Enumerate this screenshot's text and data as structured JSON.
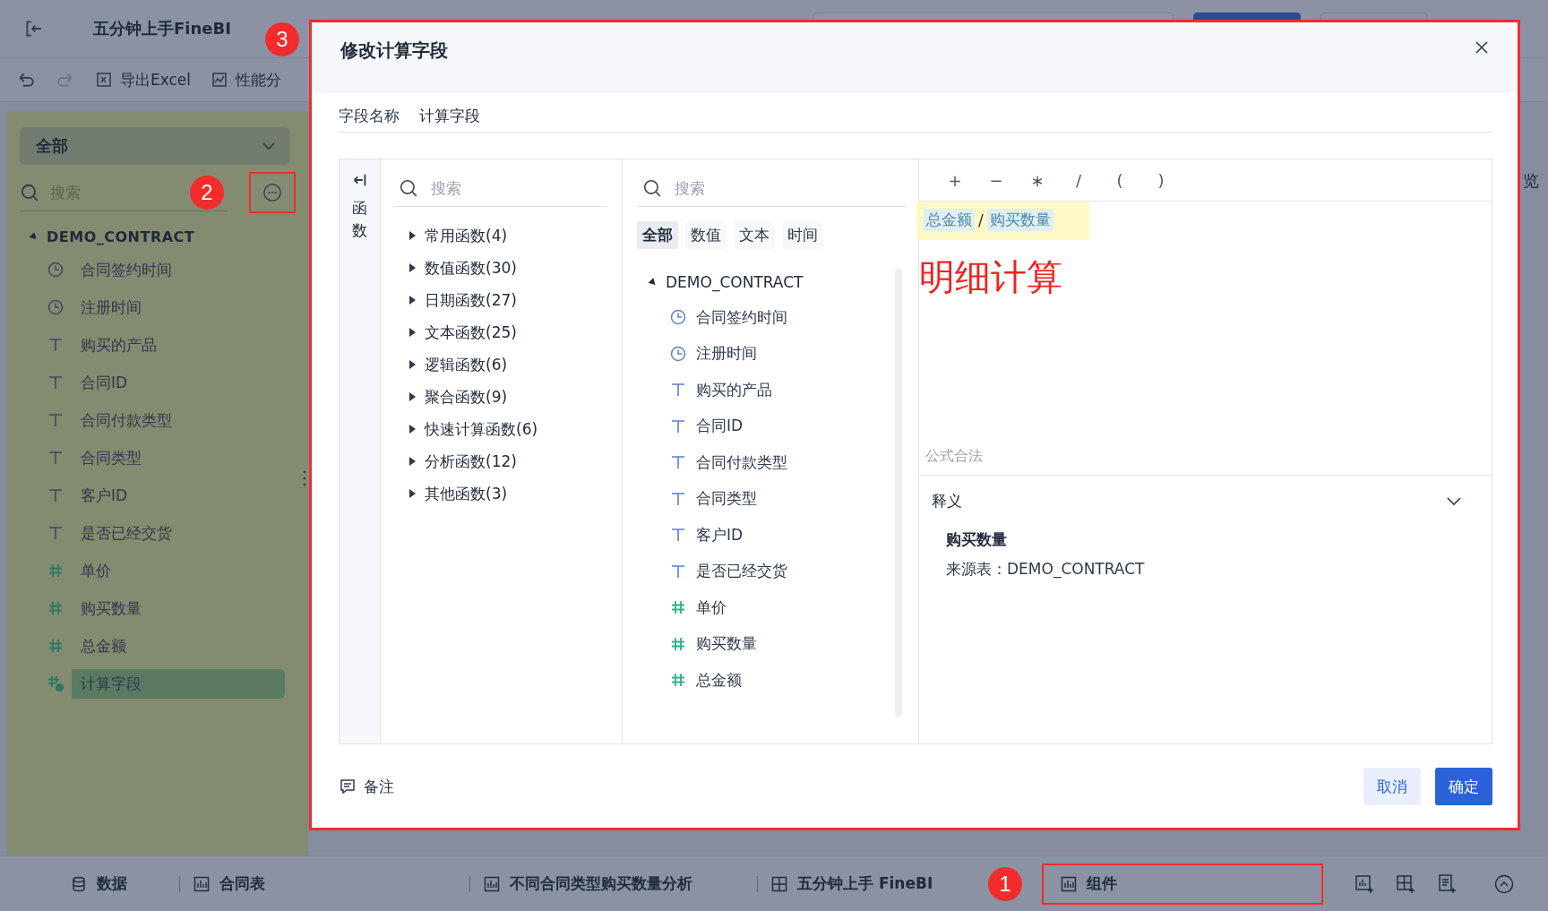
{
  "app": {
    "title": "五分钟上手FineBI"
  },
  "toolbar": [
    {
      "kind": "undo"
    },
    {
      "kind": "redo"
    },
    {
      "kind": "export",
      "label": "导出Excel"
    },
    {
      "kind": "performance",
      "label": "性能分"
    }
  ],
  "right_panel": {
    "label": "览"
  },
  "left_panel": {
    "dropdown": "全部",
    "search": {
      "placeholder": "搜索"
    },
    "more_button": {
      "highlighted": true,
      "callout": "2"
    },
    "tree": {
      "label": "DEMO_CONTRACT",
      "expanded": true,
      "children": [
        {
          "label": "合同签约时间",
          "kind": "time",
          "selected": false
        },
        {
          "label": "注册时间",
          "kind": "time",
          "selected": false
        },
        {
          "label": "购买的产品",
          "kind": "text",
          "selected": false
        },
        {
          "label": "合同ID",
          "kind": "text",
          "selected": false
        },
        {
          "label": "合同付款类型",
          "kind": "text",
          "selected": false
        },
        {
          "label": "合同类型",
          "kind": "text",
          "selected": false
        },
        {
          "label": "客户ID",
          "kind": "text",
          "selected": false
        },
        {
          "label": "是否已经交货",
          "kind": "text",
          "selected": false
        },
        {
          "label": "单价",
          "kind": "number",
          "selected": false
        },
        {
          "label": "购买数量",
          "kind": "number",
          "selected": false
        },
        {
          "label": "总金额",
          "kind": "number",
          "selected": false
        },
        {
          "label": "计算字段",
          "kind": "calc",
          "selected": true
        }
      ]
    }
  },
  "dialog": {
    "title": "修改计算字段",
    "callout": "3",
    "highlighted": true,
    "field_name": {
      "label": "字段名称",
      "value": "计算字段"
    },
    "side_tab": {
      "label": "函数"
    },
    "functions": {
      "search": {
        "placeholder": "搜索"
      },
      "groups": [
        {
          "label": "常用函数(4)",
          "expanded": false
        },
        {
          "label": "数值函数(30)",
          "expanded": false
        },
        {
          "label": "日期函数(27)",
          "expanded": false
        },
        {
          "label": "文本函数(25)",
          "expanded": false
        },
        {
          "label": "逻辑函数(6)",
          "expanded": false
        },
        {
          "label": "聚合函数(9)",
          "expanded": false
        },
        {
          "label": "快速计算函数(6)",
          "expanded": false
        },
        {
          "label": "分析函数(12)",
          "expanded": false
        },
        {
          "label": "其他函数(3)",
          "expanded": false
        }
      ]
    },
    "fields": {
      "search": {
        "placeholder": "搜索"
      },
      "filters": [
        {
          "label": "全部",
          "selected": true
        },
        {
          "label": "数值",
          "selected": false
        },
        {
          "label": "文本",
          "selected": false
        },
        {
          "label": "时间",
          "selected": false
        }
      ],
      "tree": {
        "label": "DEMO_CONTRACT",
        "expanded": true,
        "children": [
          {
            "label": "合同签约时间",
            "kind": "time"
          },
          {
            "label": "注册时间",
            "kind": "time"
          },
          {
            "label": "购买的产品",
            "kind": "text"
          },
          {
            "label": "合同ID",
            "kind": "text"
          },
          {
            "label": "合同付款类型",
            "kind": "text"
          },
          {
            "label": "合同类型",
            "kind": "text"
          },
          {
            "label": "客户ID",
            "kind": "text"
          },
          {
            "label": "是否已经交货",
            "kind": "text"
          },
          {
            "label": "单价",
            "kind": "number"
          },
          {
            "label": "购买数量",
            "kind": "number"
          },
          {
            "label": "总金额",
            "kind": "number"
          }
        ]
      }
    },
    "operators": [
      "+",
      "−",
      "∗",
      "/",
      "(",
      ")"
    ],
    "formula": {
      "highlighted": true,
      "tokens": [
        {
          "kind": "field",
          "text": "总金额"
        },
        {
          "kind": "operator",
          "text": "/"
        },
        {
          "kind": "field",
          "text": "购买数量"
        }
      ]
    },
    "annotation": "明细计算",
    "status": "公式合法",
    "explanation": {
      "title": "释义",
      "expanded": true,
      "name": "购买数量",
      "source": "来源表：DEMO_CONTRACT"
    },
    "note": "备注",
    "buttons": [
      {
        "label": "取消",
        "kind": "secondary"
      },
      {
        "label": "确定",
        "kind": "primary"
      }
    ]
  },
  "bottom_bar": {
    "tabs": [
      {
        "label": "数据",
        "kind": "data",
        "highlighted": false
      },
      {
        "label": "合同表",
        "kind": "chart",
        "highlighted": false
      },
      {
        "label": "不同合同类型购买数量分析",
        "kind": "chart",
        "highlighted": false
      },
      {
        "label": "五分钟上手 FineBI",
        "kind": "dashboard",
        "highlighted": false
      },
      {
        "label": "组件",
        "kind": "chart",
        "highlighted": true,
        "callout": "1"
      }
    ],
    "actions": [
      {
        "kind": "add-chart"
      },
      {
        "kind": "add-dashboard"
      },
      {
        "kind": "add-report"
      },
      {
        "kind": "collapse"
      }
    ]
  }
}
